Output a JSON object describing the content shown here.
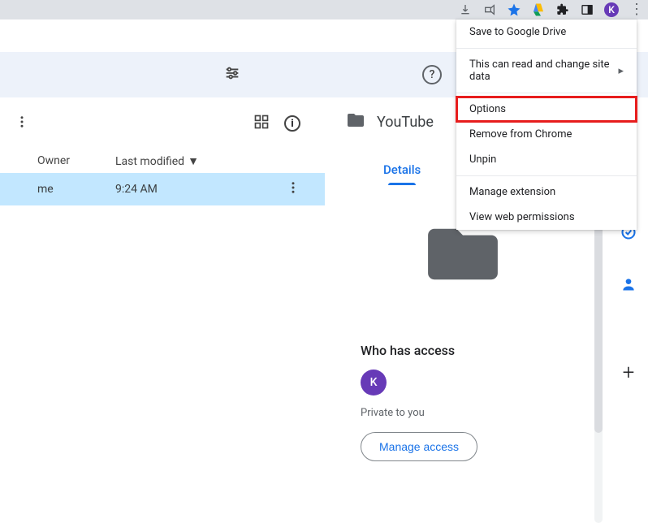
{
  "browser_icons": {
    "download": "download-icon",
    "share": "share-icon",
    "star": "star-icon",
    "drive": "drive-icon",
    "puzzle": "extensions-icon",
    "panel": "side-panel-icon",
    "avatar_letter": "K",
    "menu": "browser-menu-icon"
  },
  "ext_menu": {
    "save": "Save to Google Drive",
    "site_data": "This can read and change site data",
    "options": "Options",
    "remove": "Remove from Chrome",
    "unpin": "Unpin",
    "manage": "Manage extension",
    "perms": "View web permissions"
  },
  "drive": {
    "columns": {
      "owner_h": "Owner",
      "modified_h": "Last modified"
    },
    "rows": [
      {
        "owner": "me",
        "modified": "9:24 AM"
      }
    ],
    "detail": {
      "title": "YouTube",
      "tabs": {
        "details": "Details"
      },
      "access_h": "Who has access",
      "avatar_letter": "K",
      "private": "Private to you",
      "manage": "Manage access"
    }
  }
}
